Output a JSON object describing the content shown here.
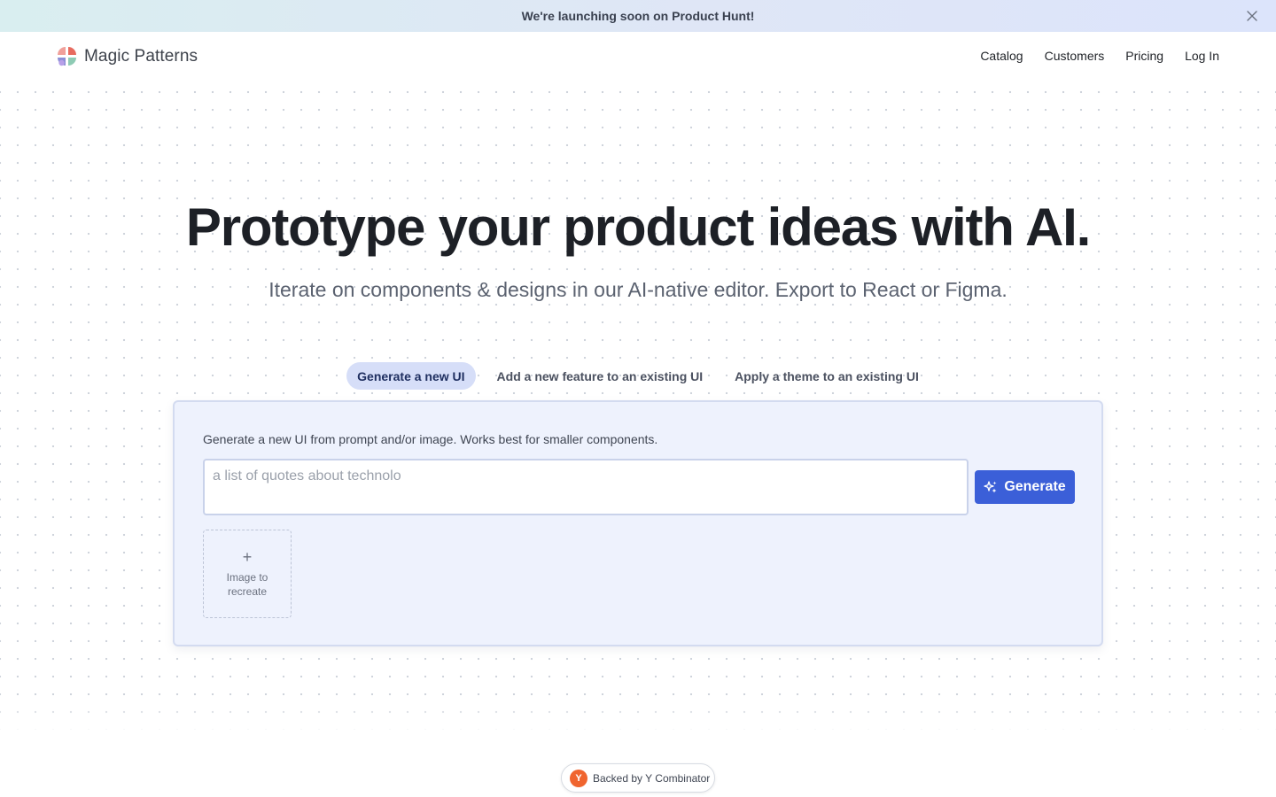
{
  "announcement": {
    "text": "We're launching soon on Product Hunt!",
    "close_icon": "close-icon"
  },
  "nav": {
    "brand_name": "Magic Patterns",
    "logo_icon": "magic-patterns-logo",
    "links": [
      "Catalog",
      "Customers",
      "Pricing",
      "Log In"
    ]
  },
  "hero": {
    "title": "Prototype your product ideas with AI.",
    "subtitle": "Iterate on components & designs in our AI-native editor. Export to React or Figma."
  },
  "tabs": [
    {
      "label": "Generate a new UI",
      "active": true
    },
    {
      "label": "Add a new feature to an existing UI",
      "active": false
    },
    {
      "label": "Apply a theme to an existing UI",
      "active": false
    }
  ],
  "generator": {
    "description": "Generate a new UI from prompt and/or image. Works best for smaller components.",
    "prompt_placeholder": "a list of quotes about technolo",
    "prompt_value": "",
    "generate_label": "Generate",
    "generate_icon": "sparkles-icon",
    "upload_icon": "plus-icon",
    "upload_label": "Image to recreate"
  },
  "badge": {
    "logo_letter": "Y",
    "text": "Backed by Y Combinator"
  },
  "colors": {
    "accent": "#3b5fd8",
    "card_bg": "#eef2fd",
    "active_tab_bg": "#d6def8",
    "yc_orange": "#f0652f"
  }
}
